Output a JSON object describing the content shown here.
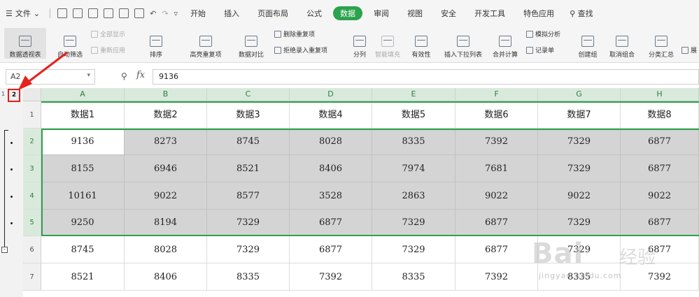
{
  "menubar": {
    "file_label": "文件",
    "tabs": [
      "开始",
      "插入",
      "页面布局",
      "公式",
      "数据",
      "审阅",
      "视图",
      "安全",
      "开发工具",
      "特色应用"
    ],
    "active_tab": "数据",
    "search_label": "查找"
  },
  "ribbon": {
    "pivot_table": "数据透视表",
    "auto_filter": "自动筛选",
    "show_all": "全部显示",
    "reapply": "重新应用",
    "sort": "排序",
    "highlight_dup": "高亮重复项",
    "data_compare": "数据对比",
    "delete_dup": "删除重复项",
    "reject_dup": "拒绝录入重复项",
    "split_column": "分列",
    "smart_fill": "智能填充",
    "validity": "有效性",
    "insert_dropdown": "插入下拉列表",
    "merge_calc": "合并计算",
    "what_if": "模拟分析",
    "record_sheet": "记录单",
    "create_group": "创建组",
    "ungroup": "取消组合",
    "subtotal": "分类汇总",
    "more": "展"
  },
  "formula_bar": {
    "name_box": "A2",
    "fx_label": "fx",
    "value": "9136"
  },
  "outline": {
    "level_one": "1",
    "level_two": "2",
    "collapse": "-"
  },
  "grid": {
    "columns": [
      "A",
      "B",
      "C",
      "D",
      "E",
      "F",
      "G",
      "H"
    ],
    "row_numbers": [
      "1",
      "2",
      "3",
      "4",
      "5",
      "6",
      "7"
    ],
    "rows": [
      [
        "数据1",
        "数据2",
        "数据3",
        "数据4",
        "数据5",
        "数据6",
        "数据7",
        "数据8"
      ],
      [
        "9136",
        "8273",
        "8745",
        "8028",
        "8335",
        "7392",
        "7329",
        "6877"
      ],
      [
        "8155",
        "6946",
        "8521",
        "8406",
        "7974",
        "7681",
        "7329",
        "6877"
      ],
      [
        "10161",
        "9022",
        "8577",
        "3528",
        "2863",
        "9022",
        "9022",
        "9022"
      ],
      [
        "9250",
        "8194",
        "7329",
        "6877",
        "7329",
        "6877",
        "7329",
        "6877"
      ],
      [
        "8745",
        "8028",
        "7329",
        "6877",
        "7329",
        "6877",
        "7329",
        "6877"
      ],
      [
        "8521",
        "8406",
        "8335",
        "7392",
        "8335",
        "7392",
        "8335",
        "7392"
      ]
    ]
  },
  "watermark": {
    "logo": "Bai",
    "cn": "经验",
    "url": "jingyan.baidu.com"
  }
}
